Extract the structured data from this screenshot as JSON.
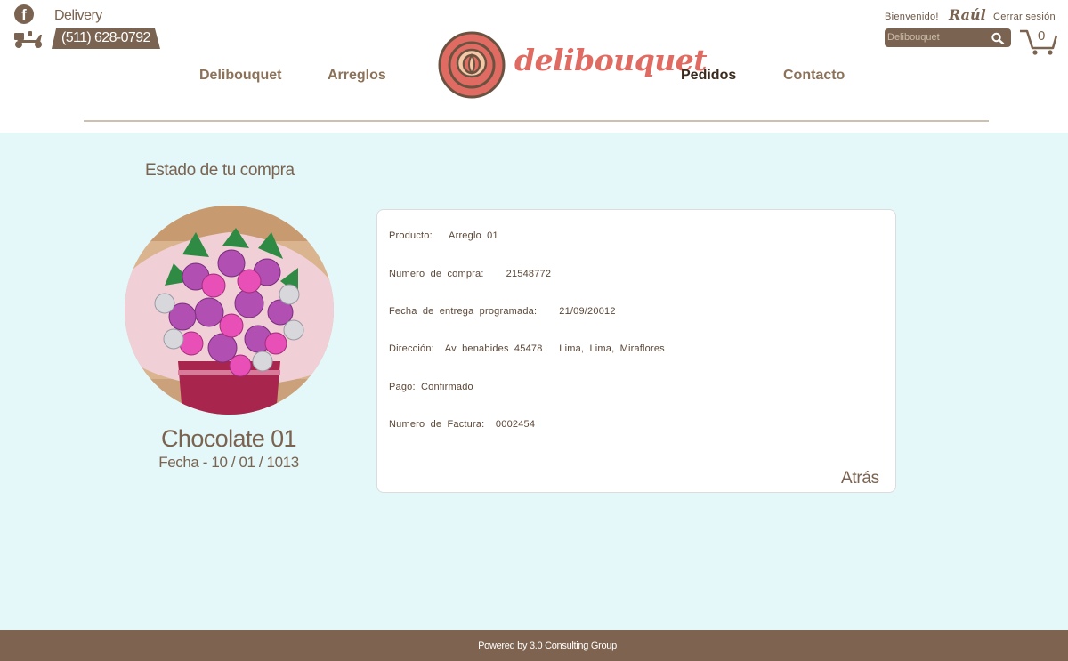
{
  "header": {
    "delivery_label": "Delivery",
    "phone": "(511) 628-0792",
    "nav": {
      "left": [
        "Delibouquet",
        "Arreglos"
      ],
      "right": [
        "Pedidos",
        "Contacto"
      ],
      "active": "Pedidos"
    },
    "logo_text": "delibouquet",
    "welcome": "Bienvenido!",
    "user_name": "Raúl",
    "logout": "Cerrar sesión",
    "search_placeholder": "Delibouquet",
    "cart_count": "0"
  },
  "main": {
    "title": "Estado de tu compra",
    "product": {
      "name": "Chocolate 01",
      "date": "Fecha - 10 / 01 / 1013"
    },
    "details": [
      "Producto:   Arreglo 01",
      "Numero de compra:    21548772",
      "Fecha de entrega programada:    21/09/20012",
      "Dirección:  Av benabides 45478   Lima, Lima, Miraflores",
      "Pago: Confirmado",
      "Numero de Factura:  0002454"
    ],
    "back_label": "Atrás"
  },
  "footer": {
    "text": "Powered by 3.0 Consulting Group"
  },
  "colors": {
    "brand_brown": "#7a6350",
    "brand_coral": "#e06b62",
    "background": "#e4f7f9",
    "footer": "#7d6350"
  }
}
